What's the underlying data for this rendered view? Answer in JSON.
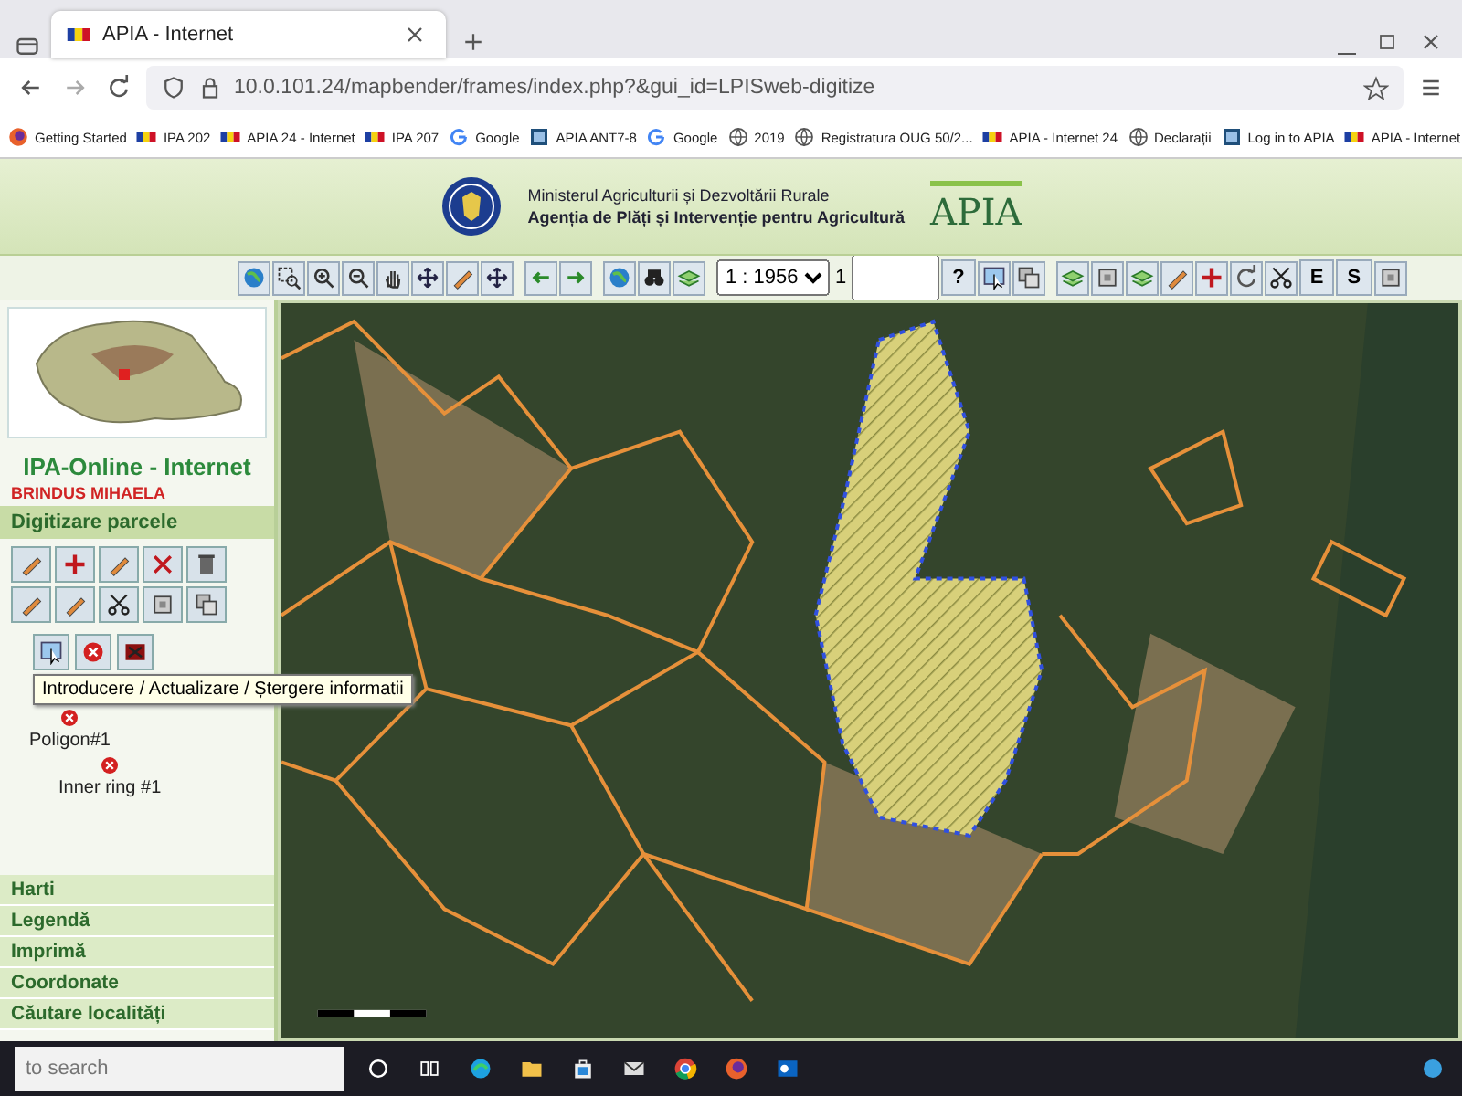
{
  "browser": {
    "tabs": [
      {
        "title": "APIA - Internet",
        "selected": true
      }
    ],
    "url": "10.0.101.24/mapbender/frames/index.php?&gui_id=LPISweb-digitize",
    "bookmarks": [
      {
        "kind": "firefox",
        "label": "Getting Started"
      },
      {
        "kind": "flag",
        "label": "IPA 202"
      },
      {
        "kind": "flag",
        "label": "APIA 24 - Internet"
      },
      {
        "kind": "flag",
        "label": "IPA 207"
      },
      {
        "kind": "google",
        "label": "Google"
      },
      {
        "kind": "app",
        "label": "APIA ANT7-8"
      },
      {
        "kind": "google",
        "label": "Google"
      },
      {
        "kind": "globe",
        "label": "2019"
      },
      {
        "kind": "globe",
        "label": "Registratura OUG 50/2..."
      },
      {
        "kind": "flag",
        "label": "APIA - Internet 24"
      },
      {
        "kind": "globe",
        "label": "Declarații"
      },
      {
        "kind": "app",
        "label": "Log in to APIA"
      },
      {
        "kind": "flag",
        "label": "APIA - Internet"
      }
    ]
  },
  "header": {
    "ministry": "Ministerul Agriculturii și Dezvoltării Rurale",
    "agency": "Agenția de Plăți și Intervenție pentru Agricultură",
    "logo": "APIA"
  },
  "toolbar": {
    "scale": "1 : 1956",
    "scale_input_label": "1",
    "help": "?",
    "text_buttons": [
      "E",
      "S"
    ]
  },
  "sidebar": {
    "title": "IPA-Online - Internet",
    "user": "BRINDUS MIHAELA",
    "panel": {
      "title": "Digitizare parcele",
      "tooltip": "Introducere / Actualizare / Ștergere informatii",
      "features": [
        {
          "label": "Poligon#1",
          "children": [
            {
              "label": "Inner ring #1"
            }
          ]
        }
      ]
    },
    "menu": [
      "Harti",
      "Legendă",
      "Imprimă",
      "Coordonate",
      "Căutare localități"
    ]
  },
  "taskbar": {
    "search_placeholder": "to search"
  }
}
